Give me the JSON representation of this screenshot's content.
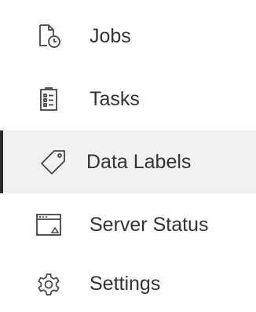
{
  "sidebar": {
    "items": [
      {
        "label": "Jobs",
        "icon": "jobs-icon",
        "active": false
      },
      {
        "label": "Tasks",
        "icon": "tasks-icon",
        "active": false
      },
      {
        "label": "Data Labels",
        "icon": "tag-icon",
        "active": true
      },
      {
        "label": "Server Status",
        "icon": "server-status-icon",
        "active": false
      },
      {
        "label": "Settings",
        "icon": "gear-icon",
        "active": false
      }
    ],
    "colors": {
      "text": "#333333",
      "icon": "#444444",
      "active_background": "#f1f1f1",
      "active_indicator": "#2a2a2a"
    }
  }
}
